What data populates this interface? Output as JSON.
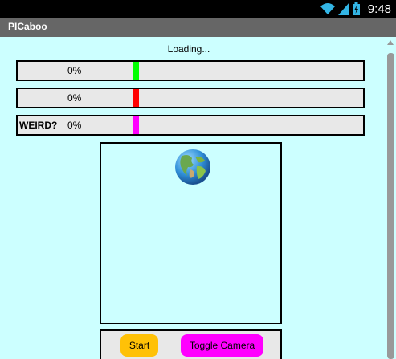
{
  "status_bar": {
    "time": "9:48",
    "icons": [
      "wifi-icon",
      "cellular-signal-icon",
      "battery-charging-icon"
    ]
  },
  "app": {
    "title": "PICaboo"
  },
  "loading_text": "Loading...",
  "bars": [
    {
      "label": "",
      "percent_text": "0%",
      "marker_color": "#00ff00"
    },
    {
      "label": "",
      "percent_text": "0%",
      "marker_color": "#ff0000"
    },
    {
      "label": "WEIRD?",
      "percent_text": "0%",
      "marker_color": "#ff00ff"
    }
  ],
  "viewport": {
    "icon": "globe-icon"
  },
  "controls": {
    "start_label": "Start",
    "toggle_camera_label": "Toggle Camera"
  },
  "colors": {
    "background": "#ccffff",
    "title_bar": "#666666",
    "start_button": "#ffc107",
    "toggle_button": "#ff00ff"
  }
}
